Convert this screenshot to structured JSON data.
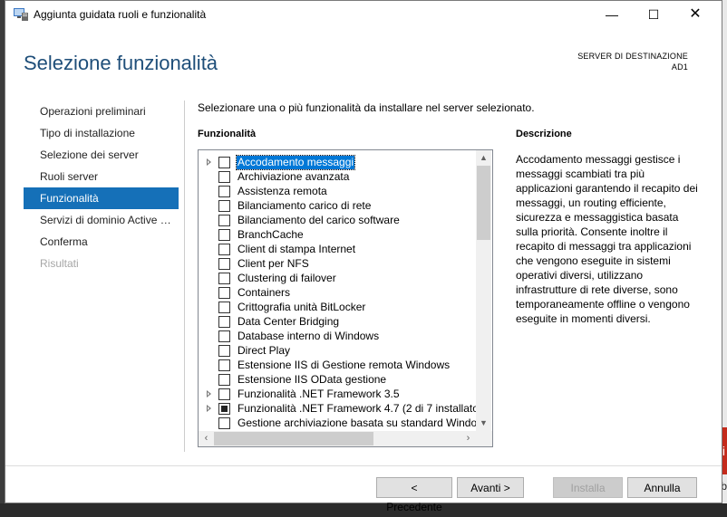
{
  "window": {
    "title": "Aggiunta guidata ruoli e funzionalità",
    "minimize": "—",
    "maximize": "☐",
    "close": "✕"
  },
  "header": {
    "page_title": "Selezione funzionalità",
    "server_label": "SERVER DI DESTINAZIONE",
    "server_name": "AD1"
  },
  "nav": {
    "items": [
      {
        "label": "Operazioni preliminari",
        "state": "normal"
      },
      {
        "label": "Tipo di installazione",
        "state": "normal"
      },
      {
        "label": "Selezione dei server",
        "state": "normal"
      },
      {
        "label": "Ruoli server",
        "state": "normal"
      },
      {
        "label": "Funzionalità",
        "state": "active"
      },
      {
        "label": "Servizi di dominio Active Directory",
        "state": "normal"
      },
      {
        "label": "Conferma",
        "state": "normal"
      },
      {
        "label": "Risultati",
        "state": "disabled"
      }
    ]
  },
  "main": {
    "instruction": "Selezionare una o più funzionalità da installare nel server selezionato.",
    "features_heading": "Funzionalità",
    "description_heading": "Descrizione",
    "description_text": "Accodamento messaggi gestisce i messaggi scambiati tra più applicazioni garantendo il recapito dei messaggi, un routing efficiente, sicurezza e messaggistica basata sulla priorità. Consente inoltre il recapito di messaggi tra applicazioni che vengono eseguite in sistemi operativi diversi, utilizzano infrastrutture di rete diverse, sono temporaneamente offline o vengono eseguite in momenti diversi."
  },
  "features": [
    {
      "label": "Accodamento messaggi",
      "expandable": true,
      "checked": "none",
      "selected": true
    },
    {
      "label": "Archiviazione avanzata",
      "expandable": false,
      "checked": "none",
      "selected": false
    },
    {
      "label": "Assistenza remota",
      "expandable": false,
      "checked": "none",
      "selected": false
    },
    {
      "label": "Bilanciamento carico di rete",
      "expandable": false,
      "checked": "none",
      "selected": false
    },
    {
      "label": "Bilanciamento del carico software",
      "expandable": false,
      "checked": "none",
      "selected": false
    },
    {
      "label": "BranchCache",
      "expandable": false,
      "checked": "none",
      "selected": false
    },
    {
      "label": "Client di stampa Internet",
      "expandable": false,
      "checked": "none",
      "selected": false
    },
    {
      "label": "Client per NFS",
      "expandable": false,
      "checked": "none",
      "selected": false
    },
    {
      "label": "Clustering di failover",
      "expandable": false,
      "checked": "none",
      "selected": false
    },
    {
      "label": "Containers",
      "expandable": false,
      "checked": "none",
      "selected": false
    },
    {
      "label": "Crittografia unità BitLocker",
      "expandable": false,
      "checked": "none",
      "selected": false
    },
    {
      "label": "Data Center Bridging",
      "expandable": false,
      "checked": "none",
      "selected": false
    },
    {
      "label": "Database interno di Windows",
      "expandable": false,
      "checked": "none",
      "selected": false
    },
    {
      "label": "Direct Play",
      "expandable": false,
      "checked": "none",
      "selected": false
    },
    {
      "label": "Estensione IIS di Gestione remota Windows",
      "expandable": false,
      "checked": "none",
      "selected": false
    },
    {
      "label": "Estensione IIS OData gestione",
      "expandable": false,
      "checked": "none",
      "selected": false
    },
    {
      "label": "Funzionalità .NET Framework 3.5",
      "expandable": true,
      "checked": "none",
      "selected": false
    },
    {
      "label": "Funzionalità .NET Framework 4.7 (2 di 7 installato/",
      "expandable": true,
      "checked": "partial",
      "selected": false
    },
    {
      "label": "Gestione archiviazione basata su standard Windov",
      "expandable": false,
      "checked": "none",
      "selected": false
    }
  ],
  "buttons": {
    "previous": "< Precedente",
    "next": "Avanti >",
    "install": "Installa",
    "cancel": "Annulla"
  },
  "background": {
    "red_tile_text": "ti",
    "bottom_text": "tib"
  },
  "colors": {
    "accent": "#1570b8",
    "title_blue": "#1e4e79",
    "selection": "#0078d7"
  }
}
